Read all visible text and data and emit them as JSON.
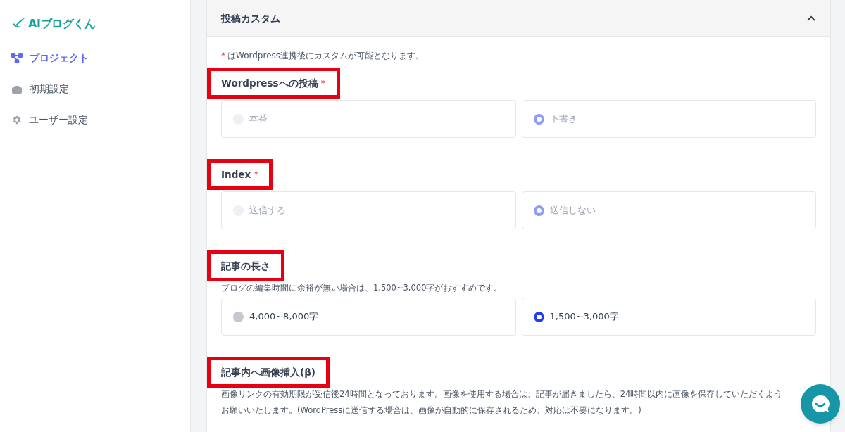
{
  "sidebar": {
    "logo": "AIブログくん",
    "items": [
      {
        "label": "プロジェクト",
        "kind": "nodes",
        "selected": true
      },
      {
        "label": "初期設定",
        "kind": "toolbox",
        "selected": false
      },
      {
        "label": "ユーザー設定",
        "kind": "gear",
        "selected": false
      }
    ]
  },
  "panel": {
    "title": "投稿カスタム",
    "expanded": true,
    "note": {
      "mark": "*",
      "text": "はWordpress連携後にカスタムが可能となります。"
    },
    "sections": [
      {
        "label": "Wordpressへの投稿",
        "required_mark": "*",
        "highlighted": true,
        "disabled": true,
        "options": [
          {
            "label": "本番",
            "selected": false
          },
          {
            "label": "下書き",
            "selected": true
          }
        ]
      },
      {
        "label": "Index",
        "required_mark": "*",
        "highlighted": true,
        "disabled": true,
        "options": [
          {
            "label": "送信する",
            "selected": false
          },
          {
            "label": "送信しない",
            "selected": true
          }
        ]
      },
      {
        "label": "記事の長さ",
        "highlighted": true,
        "disabled": false,
        "description": "ブログの編集時間に余裕が無い場合は、1,500~3,000字がおすすめです。",
        "options": [
          {
            "label": "4,000~8,000字",
            "selected": false
          },
          {
            "label": "1,500~3,000字",
            "selected": true
          }
        ]
      },
      {
        "label": "記事内へ画像挿入(β)",
        "highlighted": true,
        "description": "画像リンクの有効期限が受信後24時間となっております。画像を使用する場合は、記事が届きましたら、24時間以内に画像を保存していただくようお願いいたします。(WordPressに送信する場合は、画像が自動的に保存されるため、対応は不要になります。)"
      }
    ]
  }
}
